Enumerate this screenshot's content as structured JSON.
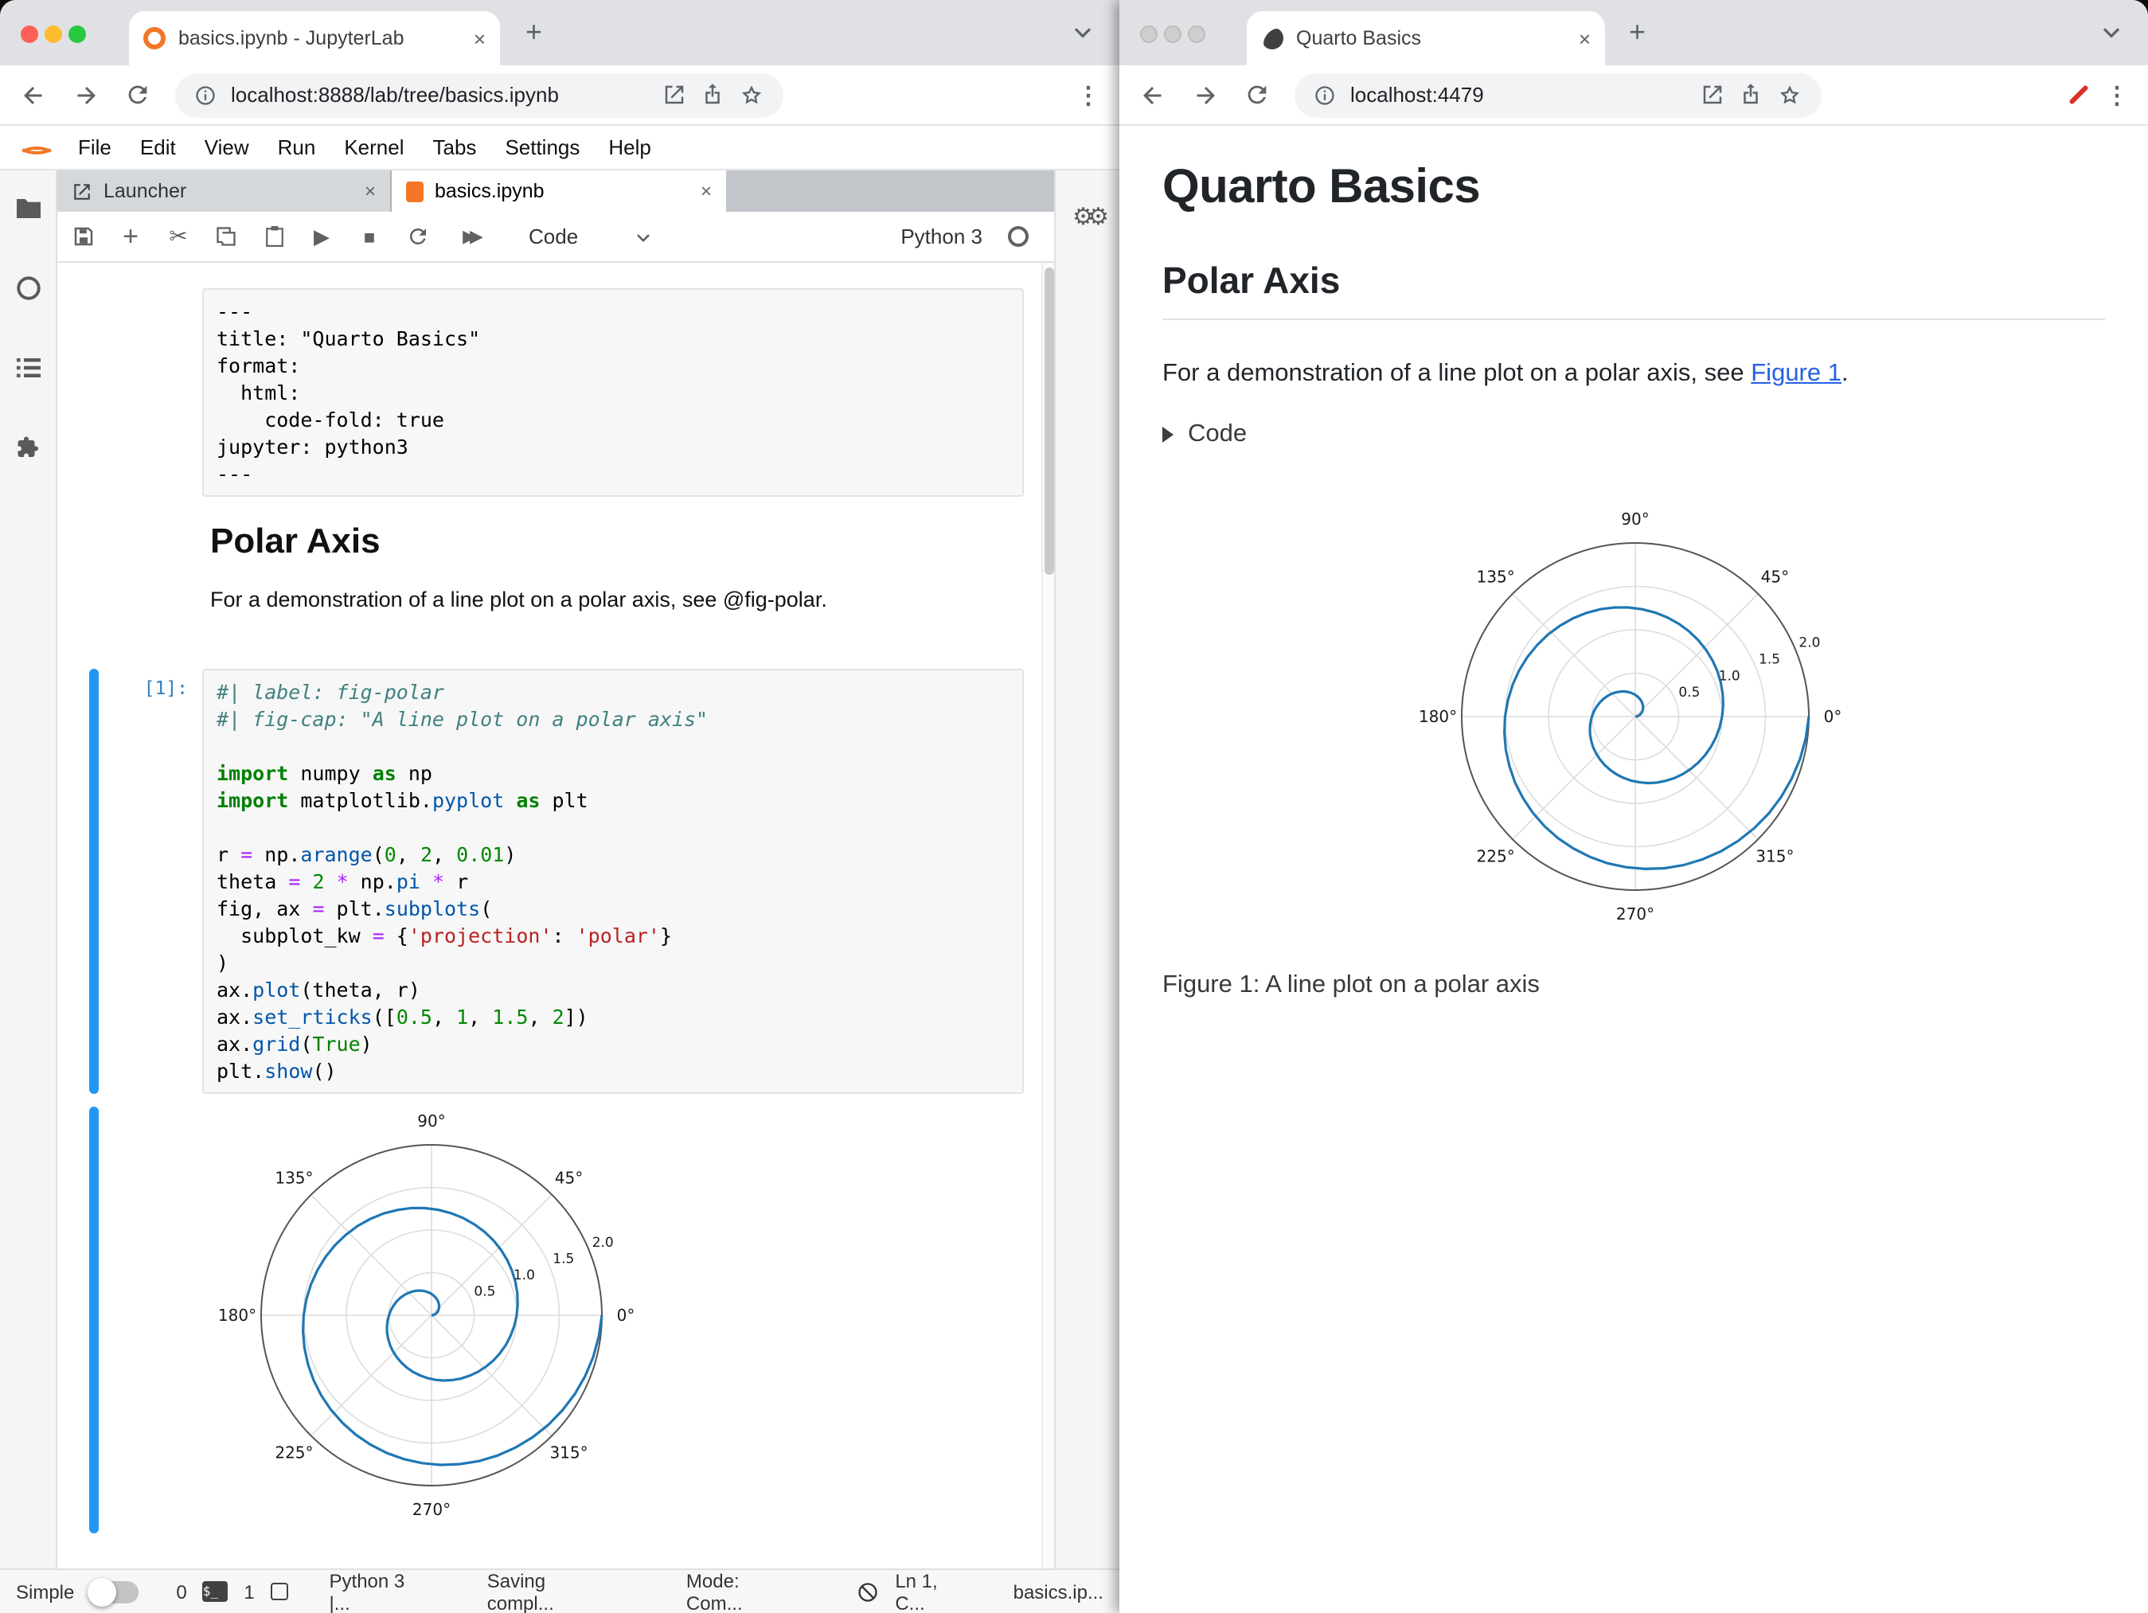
{
  "left_window": {
    "browser": {
      "tab_title": "basics.ipynb - JupyterLab",
      "url": "localhost:8888/lab/tree/basics.ipynb"
    },
    "menubar": {
      "items": [
        "File",
        "Edit",
        "View",
        "Run",
        "Kernel",
        "Tabs",
        "Settings",
        "Help"
      ]
    },
    "dock_tabs": {
      "launcher": "Launcher",
      "notebook": "basics.ipynb"
    },
    "toolbar": {
      "cell_type": "Code",
      "kernel_name": "Python 3"
    },
    "notebook": {
      "raw_cell": {
        "lines": [
          "---",
          "title: \"Quarto Basics\"",
          "format:",
          "  html:",
          "    code-fold: true",
          "jupyter: python3",
          "---"
        ]
      },
      "markdown_cell": {
        "heading": "Polar Axis",
        "paragraph": "For a demonstration of a line plot on a polar axis, see @fig-polar."
      },
      "code_cell": {
        "prompt": "[1]:",
        "lines": [
          [
            [
              "c",
              "#| label: fig-polar"
            ]
          ],
          [
            [
              "c",
              "#| fig-cap: \"A line plot on a polar axis\""
            ]
          ],
          [],
          [
            [
              "k",
              "import"
            ],
            [
              "t",
              " numpy "
            ],
            [
              "k",
              "as"
            ],
            [
              "t",
              " np"
            ]
          ],
          [
            [
              "k",
              "import"
            ],
            [
              "t",
              " matplotlib."
            ],
            [
              "p",
              "pyplot"
            ],
            [
              "t",
              " "
            ],
            [
              "k",
              "as"
            ],
            [
              "t",
              " plt"
            ]
          ],
          [],
          [
            [
              "t",
              "r "
            ],
            [
              "o",
              "="
            ],
            [
              "t",
              " np."
            ],
            [
              "p",
              "arange"
            ],
            [
              "t",
              "("
            ],
            [
              "n",
              "0"
            ],
            [
              "t",
              ", "
            ],
            [
              "n",
              "2"
            ],
            [
              "t",
              ", "
            ],
            [
              "n",
              "0.01"
            ],
            [
              "t",
              ")"
            ]
          ],
          [
            [
              "t",
              "theta "
            ],
            [
              "o",
              "="
            ],
            [
              "t",
              " "
            ],
            [
              "n",
              "2"
            ],
            [
              "t",
              " "
            ],
            [
              "o",
              "*"
            ],
            [
              "t",
              " np."
            ],
            [
              "p",
              "pi"
            ],
            [
              "t",
              " "
            ],
            [
              "o",
              "*"
            ],
            [
              "t",
              " r"
            ]
          ],
          [
            [
              "t",
              "fig, ax "
            ],
            [
              "o",
              "="
            ],
            [
              "t",
              " plt."
            ],
            [
              "p",
              "subplots"
            ],
            [
              "t",
              "("
            ]
          ],
          [
            [
              "t",
              "  subplot_kw "
            ],
            [
              "o",
              "="
            ],
            [
              "t",
              " {"
            ],
            [
              "s",
              "'projection'"
            ],
            [
              "t",
              ": "
            ],
            [
              "s",
              "'polar'"
            ],
            [
              "t",
              "}"
            ]
          ],
          [
            [
              "t",
              ")"
            ]
          ],
          [
            [
              "t",
              "ax."
            ],
            [
              "p",
              "plot"
            ],
            [
              "t",
              "(theta, r)"
            ]
          ],
          [
            [
              "t",
              "ax."
            ],
            [
              "p",
              "set_rticks"
            ],
            [
              "t",
              "(["
            ],
            [
              "n",
              "0.5"
            ],
            [
              "t",
              ", "
            ],
            [
              "n",
              "1"
            ],
            [
              "t",
              ", "
            ],
            [
              "n",
              "1.5"
            ],
            [
              "t",
              ", "
            ],
            [
              "n",
              "2"
            ],
            [
              "t",
              "])"
            ]
          ],
          [
            [
              "t",
              "ax."
            ],
            [
              "p",
              "grid"
            ],
            [
              "t",
              "("
            ],
            [
              "b",
              "True"
            ],
            [
              "t",
              ")"
            ]
          ],
          [
            [
              "t",
              "plt."
            ],
            [
              "p",
              "show"
            ],
            [
              "t",
              "()"
            ]
          ]
        ]
      }
    },
    "statusbar": {
      "simple_label": "Simple",
      "terminals_count": "0",
      "kernels_count": "1",
      "kernel_status": "Python 3 |...",
      "saving_status": "Saving compl...",
      "mode": "Mode: Com...",
      "cursor_position": "Ln 1, C...",
      "filename": "basics.ip..."
    }
  },
  "right_window": {
    "browser": {
      "tab_title": "Quarto Basics",
      "url": "localhost:4479"
    },
    "page": {
      "title": "Quarto Basics",
      "section_heading": "Polar Axis",
      "paragraph_before_link": "For a demonstration of a line plot on a polar axis, see ",
      "link_text": "Figure 1",
      "paragraph_after_link": ".",
      "code_summary": "Code",
      "figure_caption": "Figure 1: A line plot on a polar axis"
    }
  },
  "chart_data": {
    "type": "line",
    "projection": "polar",
    "description": "Archimedean spiral: r from 0 to 2 in steps of 0.01, theta = 2*pi*r (two full counterclockwise turns)",
    "r_start": 0,
    "r_end": 2,
    "r_step": 0.01,
    "r_max": 2,
    "rticks": [
      0.5,
      1.0,
      1.5,
      2.0
    ],
    "rtick_labels": [
      "0.5",
      "1.0",
      "1.5",
      "2.0"
    ],
    "theta_tick_labels": [
      "0°",
      "45°",
      "90°",
      "135°",
      "180°",
      "225°",
      "270°",
      "315°"
    ],
    "rlabel_angle_deg": 22.5,
    "line_color": "#1f77b4",
    "grid": true
  },
  "colors": {
    "jupyter_orange": "#f37726",
    "active_cell_bar": "#2196f3",
    "quarto_link": "#2761e3",
    "plot_line": "#1f77b4"
  }
}
